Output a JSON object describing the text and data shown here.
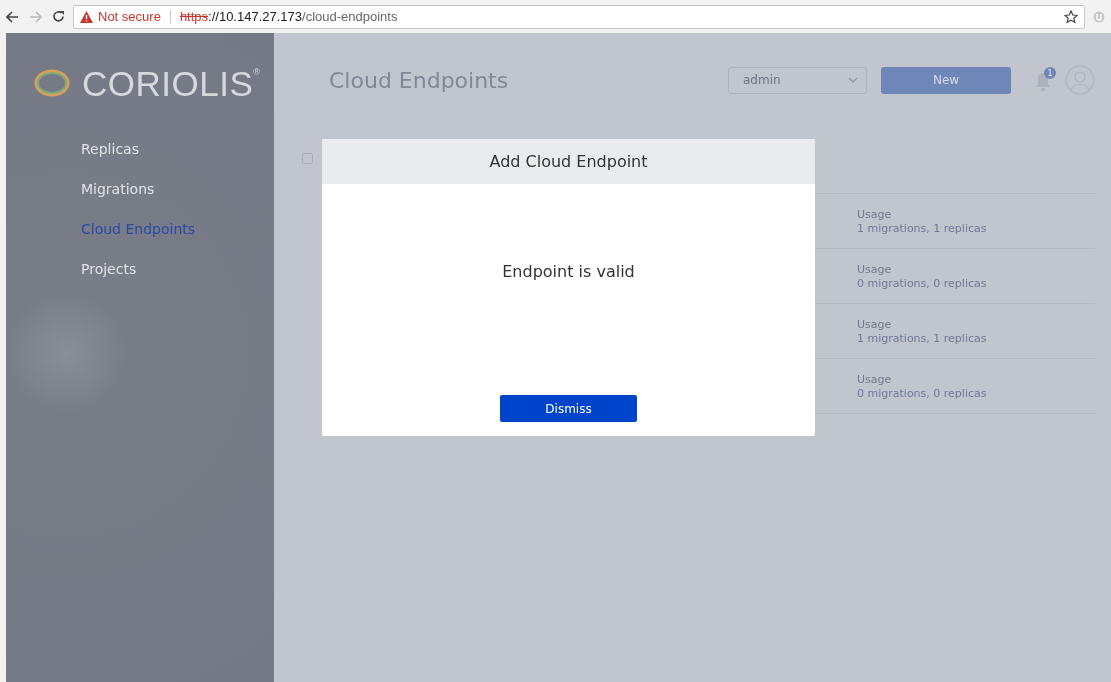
{
  "browser": {
    "security_label": "Not secure",
    "url_scheme": "https",
    "url_host": "://10.147.27.173",
    "url_path": "/cloud-endpoints"
  },
  "sidebar": {
    "logo": "CORIOLIS$^{®}$",
    "items": [
      {
        "label": "Replicas",
        "selected": false
      },
      {
        "label": "Migrations",
        "selected": false
      },
      {
        "label": "Cloud Endpoints",
        "selected": true
      },
      {
        "label": "Projects",
        "selected": false
      }
    ]
  },
  "header": {
    "title": "Cloud Endpoints",
    "project_select": {
      "value": "admin"
    },
    "new_button": "New",
    "notification_count": "1"
  },
  "table": {
    "select_all": {
      "checked": false
    },
    "rows": [
      {
        "usage_label": "Usage",
        "usage": "1 migrations, 1 replicas"
      },
      {
        "usage_label": "Usage",
        "usage": "0 migrations, 0 replicas"
      },
      {
        "usage_label": "Usage",
        "usage": "1 migrations, 1 replicas"
      },
      {
        "usage_label": "Usage",
        "usage": "0 migrations, 0 replicas"
      }
    ]
  },
  "modal": {
    "title": "Add Cloud Endpoint",
    "message": "Endpoint is valid",
    "button": "Dismiss"
  }
}
